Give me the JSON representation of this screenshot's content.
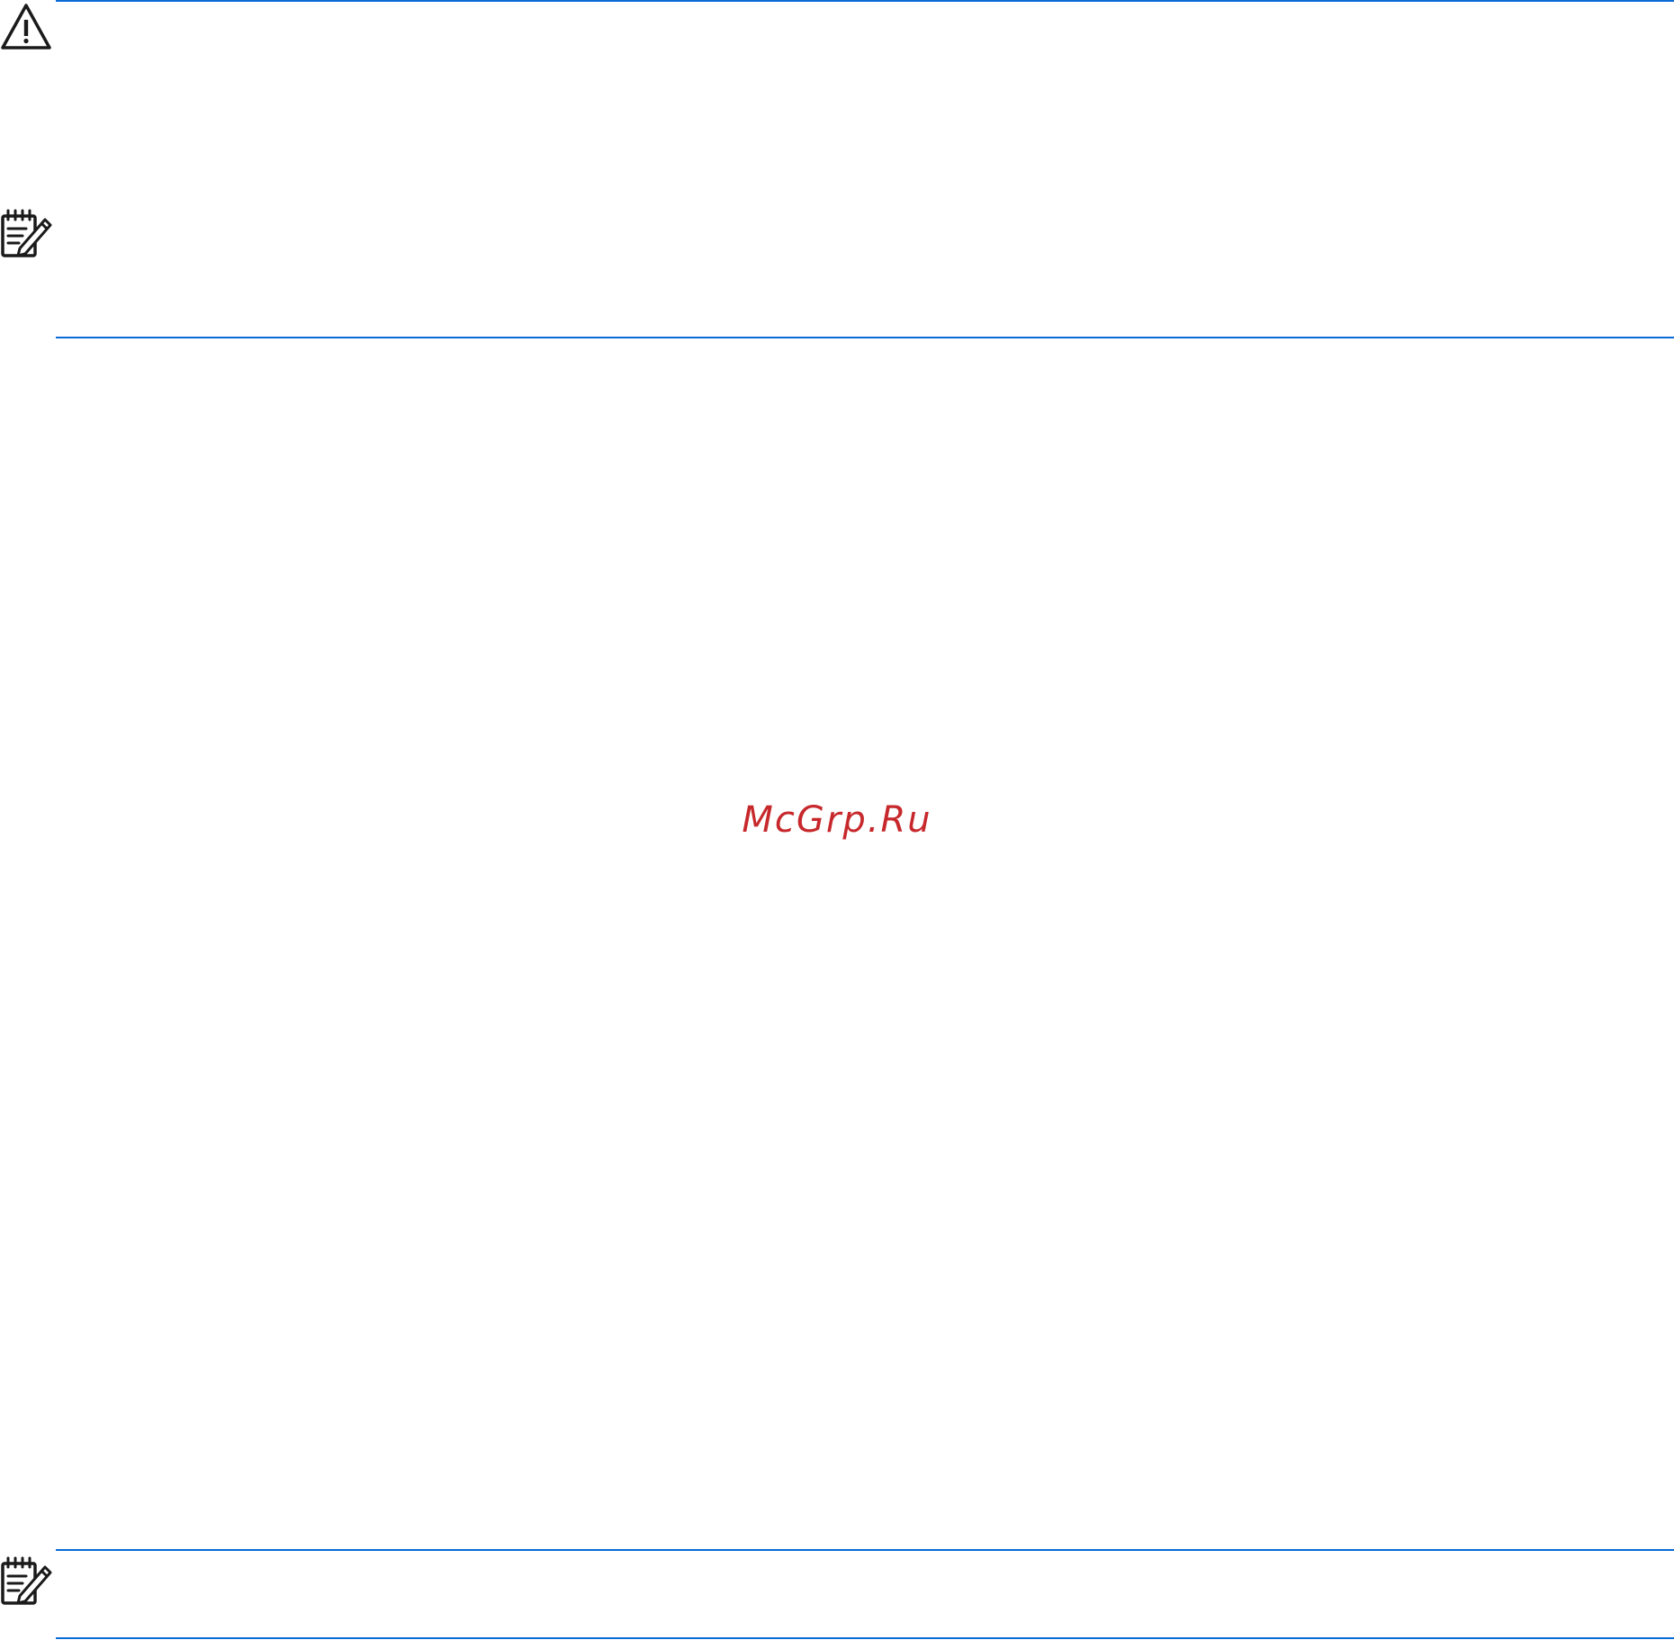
{
  "watermark": {
    "text": "McGrp.Ru",
    "color": "#c7282c"
  },
  "notices": [
    {
      "kind": "warning",
      "icon": "warning-triangle-icon"
    },
    {
      "kind": "note",
      "icon": "note-pad-icon"
    },
    {
      "kind": "note",
      "icon": "note-pad-icon"
    }
  ],
  "colors": {
    "rule": "#0a6ad6",
    "icon": "#1a1a1a",
    "background": "#ffffff"
  }
}
